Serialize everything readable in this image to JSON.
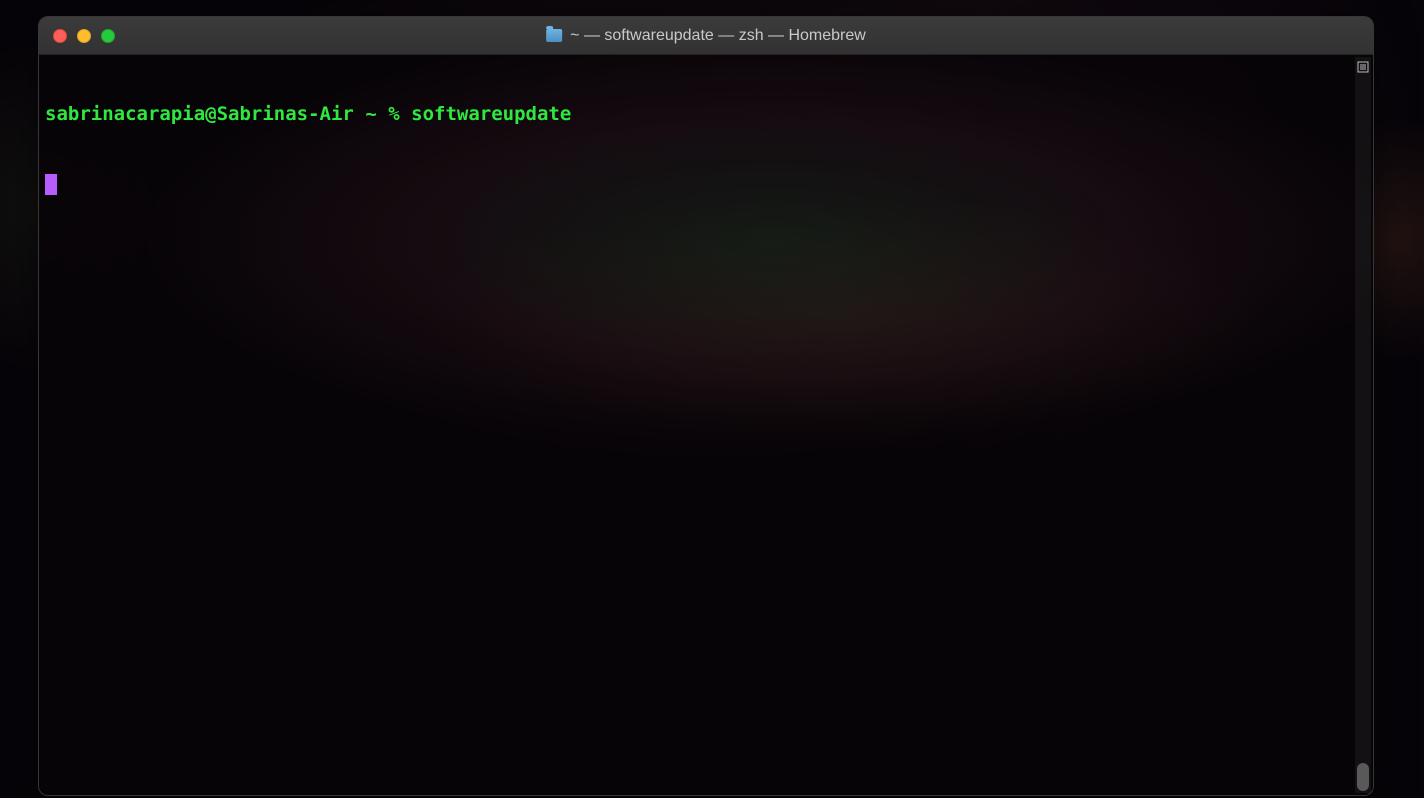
{
  "window": {
    "title": "~ — softwareupdate — zsh — Homebrew"
  },
  "terminal": {
    "prompt_user_host": "sabrinacarapia@Sabrinas-Air",
    "prompt_path": "~",
    "prompt_symbol": "%",
    "command": "softwareupdate"
  }
}
